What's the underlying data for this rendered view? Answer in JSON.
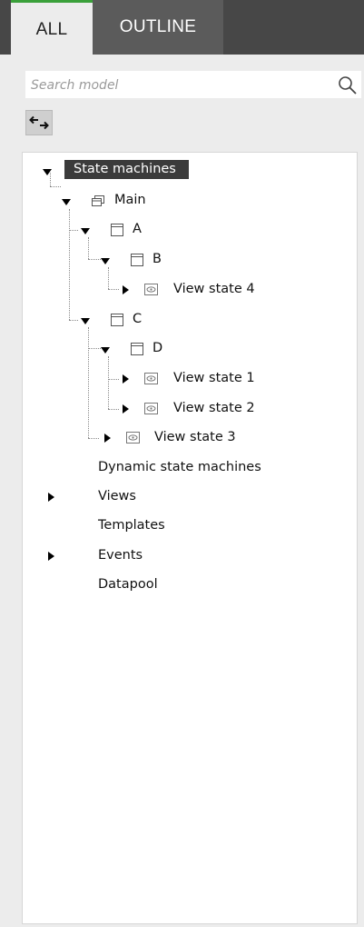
{
  "tabs": {
    "all_label": "ALL",
    "outline_label": "OUTLINE"
  },
  "search": {
    "placeholder": "Search model",
    "value": ""
  },
  "toolbar": {
    "link_toggle_icon": "link-arrows-icon"
  },
  "tree": {
    "state_machines": "State machines",
    "main": "Main",
    "a": "A",
    "b": "B",
    "view_state_4": "View state 4",
    "c": "C",
    "d": "D",
    "view_state_1": "View state 1",
    "view_state_2": "View state 2",
    "view_state_3": "View state 3",
    "dynamic_state_machines": "Dynamic state machines",
    "views": "Views",
    "templates": "Templates",
    "events": "Events",
    "datapool": "Datapool"
  },
  "colors": {
    "active_tab_accent": "#3aa03a",
    "selected_background": "#3b3b3b",
    "tabbar_background": "#474747"
  }
}
